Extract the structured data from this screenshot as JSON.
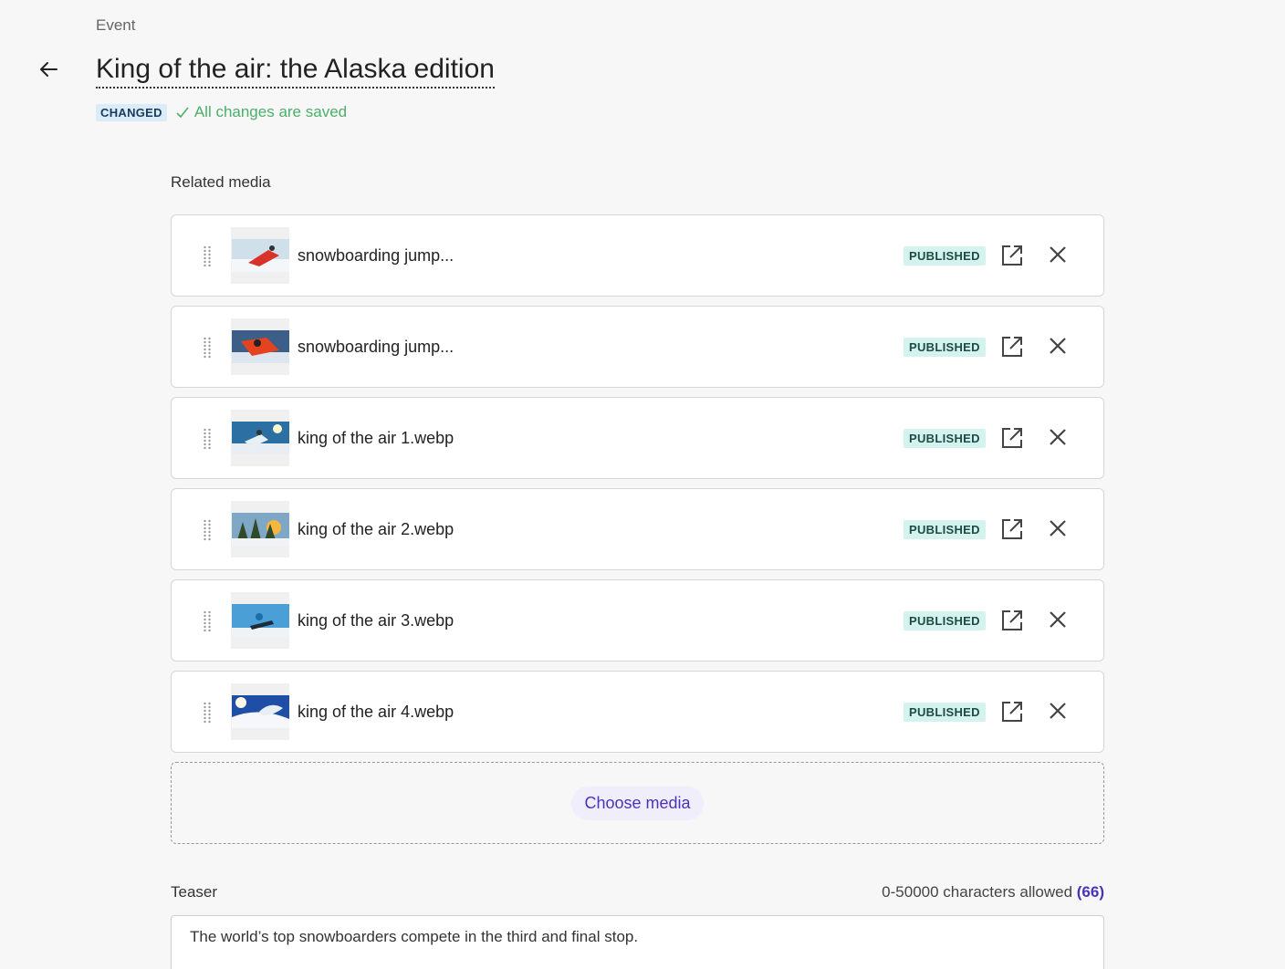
{
  "header": {
    "eyebrow": "Event",
    "title": "King of the air: the Alaska edition",
    "status_badge": "CHANGED",
    "saved_text": "All changes are saved"
  },
  "related_media": {
    "label": "Related media",
    "items": [
      {
        "name": "snowboarding jump...",
        "status": "PUBLISHED",
        "thumb": "snowboarder-red-jacket-jump"
      },
      {
        "name": "snowboarding jump...",
        "status": "PUBLISHED",
        "thumb": "snowboarder-red-jacket-closeup"
      },
      {
        "name": "king of the air 1.webp",
        "status": "PUBLISHED",
        "thumb": "snowboarder-blue-sky"
      },
      {
        "name": "king of the air 2.webp",
        "status": "PUBLISHED",
        "thumb": "snowy-forest-sunset"
      },
      {
        "name": "king of the air 3.webp",
        "status": "PUBLISHED",
        "thumb": "snowboarder-air-blue-sky"
      },
      {
        "name": "king of the air 4.webp",
        "status": "PUBLISHED",
        "thumb": "snowboarder-spray-sun"
      }
    ],
    "choose_label": "Choose media"
  },
  "teaser": {
    "label": "Teaser",
    "limit_text": "0-50000 characters allowed",
    "count": "(66)",
    "value": "The world’s top snowboarders compete in the third and final stop."
  },
  "colors": {
    "accent": "#4b33b8",
    "saved_green": "#4caf6a",
    "published_bg": "#d5f3ee",
    "changed_bg": "#d9ecf7"
  },
  "icons": {
    "back": "arrow-left-icon",
    "saved": "checkmark-icon",
    "drag": "drag-handle-icon",
    "open": "external-link-icon",
    "remove": "close-icon"
  }
}
